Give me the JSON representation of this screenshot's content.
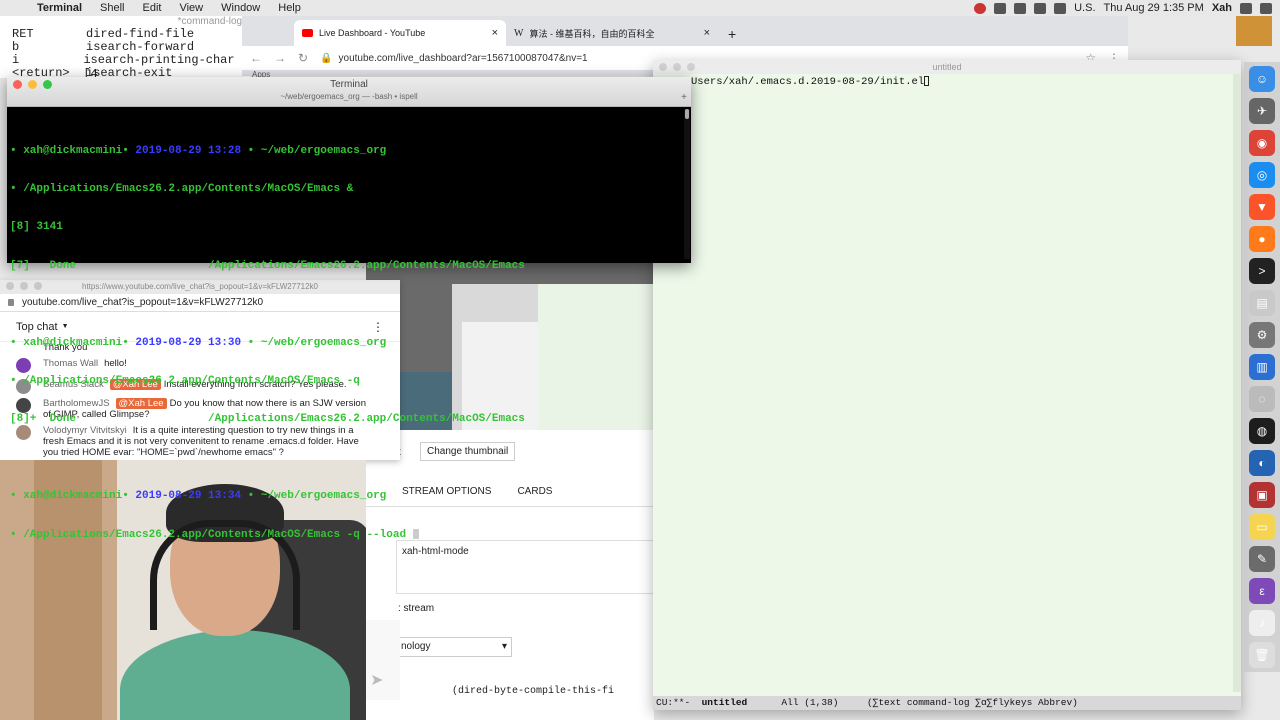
{
  "menubar": {
    "app": "Terminal",
    "menus": [
      "Shell",
      "Edit",
      "View",
      "Window",
      "Help"
    ],
    "input_source": "U.S.",
    "clock": "Thu Aug 29  1:35 PM",
    "user": "Xah"
  },
  "command_log": {
    "title": "*command-log*",
    "rows": [
      {
        "key": "RET",
        "cmd": "dired-find-file"
      },
      {
        "key": "b",
        "cmd": "isearch-forward"
      },
      {
        "key": "i",
        "cmd": "isearch-printing-char [4"
      },
      {
        "key": "<return>",
        "cmd": "isearch-exit"
      }
    ]
  },
  "browser": {
    "tabs": [
      {
        "title": "Live Dashboard - YouTube",
        "close": "×"
      },
      {
        "title": "算法 - 维基百科，自由的百科全",
        "close": "×"
      }
    ],
    "new_tab": "+",
    "url": "youtube.com/live_dashboard?ar=1567100087047&nv=1",
    "bookmarks_label": "Apps"
  },
  "terminal": {
    "title": "Terminal",
    "subtitle": "~/web/ergoemacs_org — -bash • ispell",
    "lines": [
      {
        "prompt": "• xah@dickmacmini• ",
        "date": "2019-08-29 13:28",
        "path": " • ~/web/ergoemacs_org"
      },
      {
        "text": "• /Applications/Emacs26.2.app/Contents/MacOS/Emacs &"
      },
      {
        "text": "[8] 3141"
      },
      {
        "text": "[7]   Done                    /Applications/Emacs26.2.app/Contents/MacOS/Emacs"
      },
      {
        "text": ""
      },
      {
        "prompt": "• xah@dickmacmini• ",
        "date": "2019-08-29 13:30",
        "path": " • ~/web/ergoemacs_org"
      },
      {
        "text": "• /Applications/Emacs26.2.app/Contents/MacOS/Emacs -q"
      },
      {
        "text": "[8]+  Done                    /Applications/Emacs26.2.app/Contents/MacOS/Emacs"
      },
      {
        "text": ""
      },
      {
        "prompt": "• xah@dickmacmini• ",
        "date": "2019-08-29 13:34",
        "path": " • ~/web/ergoemacs_org"
      },
      {
        "text": "• /Applications/Emacs26.2.app/Contents/MacOS/Emacs -q --load "
      }
    ]
  },
  "chat": {
    "window_url": "https://www.youtube.com/live_chat?is_popout=1&v=kFLW27712k0",
    "address": "youtube.com/live_chat?is_popout=1&v=kFLW27712k0",
    "header": "Top chat",
    "messages": [
      {
        "author": "",
        "badge": "",
        "text": "Thank you",
        "color": "#9a9a9a"
      },
      {
        "author": "Thomas Wall",
        "badge": "",
        "text": "hello!",
        "color": "#7b3fb3"
      },
      {
        "author": "Seamus Slack",
        "badge": "@Xah Lee",
        "text": "Install everything from scratch? Yes please.",
        "color": "#8c8c8c"
      },
      {
        "author": "BartholomewJS",
        "badge": "@Xah Lee",
        "text": "Do you know that now there is an SJW version of GIMP, called Glimpse?",
        "color": "#444444"
      },
      {
        "author": "Volodymyr Vitvitskyi",
        "badge": "",
        "text": "It is a quite interesting question to try new things in a fresh Emacs and it is not very convenitent to rename .emacs.d folder. Have you tried HOME evar: \"HOME=`pwd`/newhome emacs\" ?",
        "color": "#a88a78"
      }
    ]
  },
  "dashboard": {
    "change_thumbnail": "Change thumbnail",
    "left_fragment": "t",
    "tabs": [
      "STREAM OPTIONS",
      "CARDS"
    ],
    "mode_field": "xah-html-mode",
    "stream_label": ": stream",
    "category": "nology",
    "lower_text": "(dired-byte-compile-this-fi"
  },
  "emacs": {
    "title": "untitled",
    "buffer_text": "Users/xah/.emacs.d.2019-08-29/init.el",
    "modeline": {
      "status": "CU:**-  ",
      "buffer": "untitled",
      "position": "      All (1,38)     ",
      "modes": "(∑text command-log ∑α∑flykeys Abbrev)"
    }
  },
  "dock": {
    "icons": [
      {
        "name": "finder-icon",
        "color": "#3a8ee6",
        "glyph": "☺"
      },
      {
        "name": "launchpad-icon",
        "color": "#666666",
        "glyph": "✈"
      },
      {
        "name": "chrome-icon",
        "color": "#db4437",
        "glyph": "◉"
      },
      {
        "name": "safari-icon",
        "color": "#1b8cf0",
        "glyph": "◎"
      },
      {
        "name": "brave-icon",
        "color": "#fb542b",
        "glyph": "▼"
      },
      {
        "name": "firefox-icon",
        "color": "#ff7a1a",
        "glyph": "●"
      },
      {
        "name": "terminal-icon",
        "color": "#222222",
        "glyph": ">"
      },
      {
        "name": "preview-icon",
        "color": "#c9c9c9",
        "glyph": "▤"
      },
      {
        "name": "system-prefs-icon",
        "color": "#777777",
        "glyph": "⚙"
      },
      {
        "name": "activity-monitor-icon",
        "color": "#2a6fd1",
        "glyph": "▥"
      },
      {
        "name": "disk-utility-icon",
        "color": "#bbbbbb",
        "glyph": "◌"
      },
      {
        "name": "obs-icon",
        "color": "#1d1d1d",
        "glyph": "◍"
      },
      {
        "name": "edge-icon",
        "color": "#2563b3",
        "glyph": "◐"
      },
      {
        "name": "photo-booth-icon",
        "color": "#b33232",
        "glyph": "▣"
      },
      {
        "name": "notes-icon",
        "color": "#f5d452",
        "glyph": "▭"
      },
      {
        "name": "gimp-icon",
        "color": "#6b6b6b",
        "glyph": "✎"
      },
      {
        "name": "emacs-icon",
        "color": "#7d4ab8",
        "glyph": "ε"
      },
      {
        "name": "music-file-icon",
        "color": "#eeeeee",
        "glyph": "♪"
      },
      {
        "name": "trash-icon",
        "color": "#dddddd",
        "glyph": "🗑"
      }
    ]
  }
}
